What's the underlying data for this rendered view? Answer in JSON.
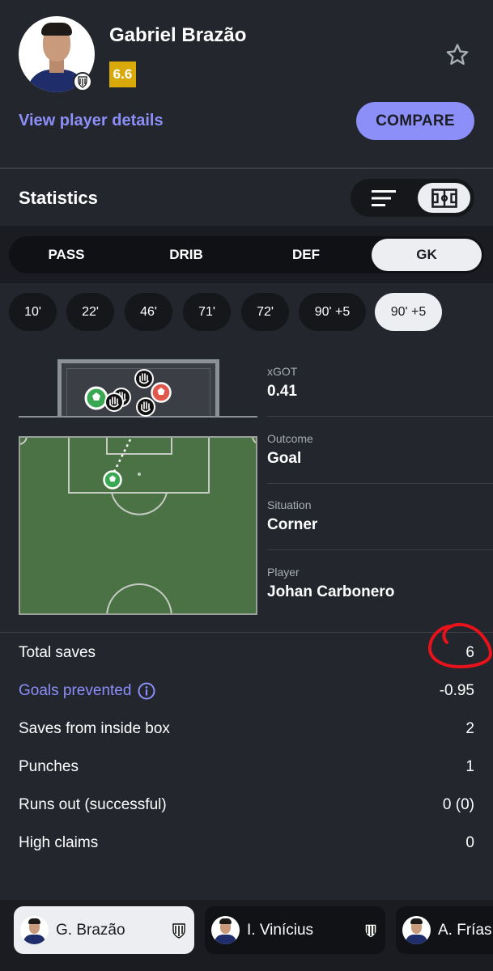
{
  "player": {
    "name": "Gabriel Brazão",
    "rating": "6.6",
    "view_details": "View player details",
    "compare": "COMPARE"
  },
  "statistics": {
    "title": "Statistics",
    "tabs": [
      {
        "label": "PASS",
        "active": false
      },
      {
        "label": "DRIB",
        "active": false
      },
      {
        "label": "DEF",
        "active": false
      },
      {
        "label": "GK",
        "active": true
      }
    ],
    "minutes": [
      {
        "label": "10'",
        "active": false
      },
      {
        "label": "22'",
        "active": false
      },
      {
        "label": "46'",
        "active": false
      },
      {
        "label": "71'",
        "active": false
      },
      {
        "label": "72'",
        "active": false
      },
      {
        "label": "90' +5",
        "active": false
      },
      {
        "label": "90' +5",
        "active": true
      }
    ]
  },
  "shot": {
    "xgot_label": "xGOT",
    "xgot_value": "0.41",
    "outcome_label": "Outcome",
    "outcome_value": "Goal",
    "situation_label": "Situation",
    "situation_value": "Corner",
    "player_label": "Player",
    "player_value": "Johan Carbonero"
  },
  "gk_stats": [
    {
      "label": "Total saves",
      "value": "6",
      "link": false
    },
    {
      "label": "Goals prevented",
      "value": "-0.95",
      "link": true
    },
    {
      "label": "Saves from inside box",
      "value": "2",
      "link": false
    },
    {
      "label": "Punches",
      "value": "1",
      "link": false
    },
    {
      "label": "Runs out (successful)",
      "value": "0 (0)",
      "link": false
    },
    {
      "label": "High claims",
      "value": "0",
      "link": false
    }
  ],
  "lineup": [
    {
      "name": "G. Brazão",
      "active": true
    },
    {
      "name": "I. Vinícius",
      "active": false
    },
    {
      "name": "A. Frías",
      "active": false
    }
  ],
  "colors": {
    "background": "#23262d",
    "accent": "#8b8ff7",
    "rating": "#d9a90a",
    "pitch": "#4a7244",
    "goal_ball": "#3aa852",
    "blocked_ball": "#e2574c",
    "annotation": "#e8131a"
  }
}
